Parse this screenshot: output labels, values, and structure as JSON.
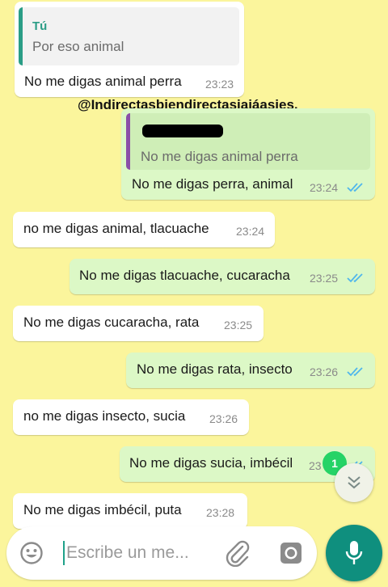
{
  "colors": {
    "wallpaper": "#fbf59c",
    "incoming_bubble": "#ffffff",
    "outgoing_bubble": "#dcf8c6",
    "read_ticks": "#4fb6ec",
    "accent": "#0f8f7e",
    "unread_badge": "#25d366"
  },
  "watermark": "@Indirectasbiendirectasjajáasies.",
  "messages": [
    {
      "direction": "in",
      "quote_author": "Tú",
      "quote_text": "Por eso animal",
      "text": "No me digas animal perra",
      "time": "23:23"
    },
    {
      "direction": "out",
      "quote_author": "",
      "quote_text": "No me digas animal perra",
      "text": "No me digas perra, animal",
      "time": "23:24",
      "ticks": "read"
    },
    {
      "direction": "in",
      "text": "no me digas animal, tlacuache",
      "time": "23:24"
    },
    {
      "direction": "out",
      "text": "No me digas tlacuache, cucaracha",
      "time": "23:25",
      "ticks": "read"
    },
    {
      "direction": "in",
      "text": "No me digas cucaracha, rata",
      "time": "23:25"
    },
    {
      "direction": "out",
      "text": "No me digas rata, insecto",
      "time": "23:26",
      "ticks": "read"
    },
    {
      "direction": "in",
      "text": "no me digas insecto, sucia",
      "time": "23:26"
    },
    {
      "direction": "out",
      "text": "No me digas sucia, imbécil",
      "time": "23",
      "ticks": "read"
    },
    {
      "direction": "in",
      "text": "No me digas imbécil, puta",
      "time": "23:28"
    }
  ],
  "unread_count": "1",
  "scroll_button_icon": "chevron-down-icon",
  "composer": {
    "placeholder": "Escribe un me...",
    "emoji_icon": "emoji-icon",
    "attach_icon": "paperclip-icon",
    "camera_icon": "camera-icon",
    "mic_icon": "microphone-icon"
  }
}
